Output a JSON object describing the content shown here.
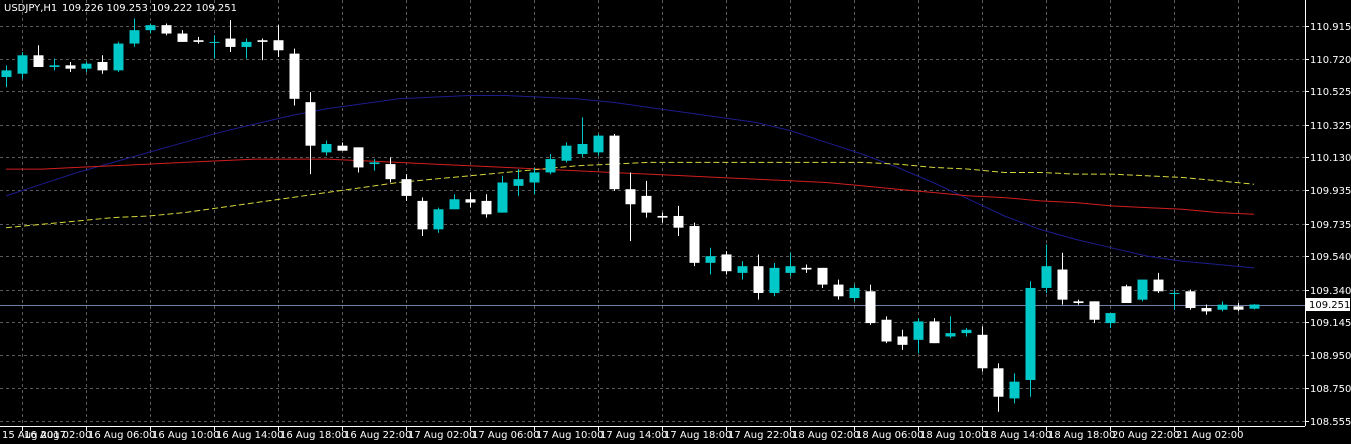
{
  "header": {
    "symbol_timeframe": "USDJPY,H1",
    "ohlc": "109.226 109.253 109.222 109.251"
  },
  "price_box": {
    "label": "109.251"
  },
  "colors": {
    "background": "#000000",
    "bull_candle": "#00c8c8",
    "bear_candle": "#ffffff",
    "ma_fast": "#1c1c8c",
    "ma_mid": "#d21e1e",
    "ma_slow": "#d7d73c",
    "price_line": "#6a7fa5",
    "grid": "#5a5a5a",
    "text": "#ffffff"
  },
  "chart_data": {
    "type": "candlestick",
    "symbol": "USDJPY",
    "timeframe": "H1",
    "ylim": [
      108.555,
      111.0
    ],
    "grid": true,
    "current_price": 109.251,
    "y_ticks": [
      "110.915",
      "110.720",
      "110.525",
      "110.325",
      "110.130",
      "109.935",
      "109.735",
      "109.540",
      "109.340",
      "109.145",
      "108.950",
      "108.750",
      "108.555"
    ],
    "x_ticks": [
      {
        "i": 1,
        "label": "15 Aug 2017"
      },
      {
        "i": 5,
        "label": "16 Aug 02:00"
      },
      {
        "i": 9,
        "label": "16 Aug 06:00"
      },
      {
        "i": 13,
        "label": "16 Aug 10:00"
      },
      {
        "i": 17,
        "label": "16 Aug 14:00"
      },
      {
        "i": 21,
        "label": "16 Aug 18:00"
      },
      {
        "i": 25,
        "label": "16 Aug 22:00"
      },
      {
        "i": 29,
        "label": "17 Aug 02:00"
      },
      {
        "i": 33,
        "label": "17 Aug 06:00"
      },
      {
        "i": 37,
        "label": "17 Aug 10:00"
      },
      {
        "i": 41,
        "label": "17 Aug 14:00"
      },
      {
        "i": 45,
        "label": "17 Aug 18:00"
      },
      {
        "i": 49,
        "label": "17 Aug 22:00"
      },
      {
        "i": 53,
        "label": "18 Aug 02:00"
      },
      {
        "i": 57,
        "label": "18 Aug 06:00"
      },
      {
        "i": 61,
        "label": "18 Aug 10:00"
      },
      {
        "i": 65,
        "label": "18 Aug 14:00"
      },
      {
        "i": 69,
        "label": "18 Aug 18:00"
      },
      {
        "i": 73,
        "label": "20 Aug 22:00"
      },
      {
        "i": 77,
        "label": "21 Aug 02:00"
      }
    ],
    "candles": [
      {
        "o": 110.61,
        "h": 110.68,
        "l": 110.55,
        "c": 110.65
      },
      {
        "o": 110.63,
        "h": 110.76,
        "l": 110.6,
        "c": 110.74
      },
      {
        "o": 110.74,
        "h": 110.8,
        "l": 110.67,
        "c": 110.67
      },
      {
        "o": 110.67,
        "h": 110.72,
        "l": 110.65,
        "c": 110.68
      },
      {
        "o": 110.68,
        "h": 110.7,
        "l": 110.64,
        "c": 110.66
      },
      {
        "o": 110.66,
        "h": 110.7,
        "l": 110.64,
        "c": 110.69
      },
      {
        "o": 110.7,
        "h": 110.74,
        "l": 110.63,
        "c": 110.65
      },
      {
        "o": 110.65,
        "h": 110.82,
        "l": 110.64,
        "c": 110.81
      },
      {
        "o": 110.81,
        "h": 110.96,
        "l": 110.79,
        "c": 110.89
      },
      {
        "o": 110.89,
        "h": 110.93,
        "l": 110.87,
        "c": 110.92
      },
      {
        "o": 110.92,
        "h": 110.93,
        "l": 110.86,
        "c": 110.87
      },
      {
        "o": 110.87,
        "h": 110.89,
        "l": 110.82,
        "c": 110.82
      },
      {
        "o": 110.83,
        "h": 110.85,
        "l": 110.81,
        "c": 110.82
      },
      {
        "o": 110.82,
        "h": 110.86,
        "l": 110.72,
        "c": 110.82
      },
      {
        "o": 110.84,
        "h": 110.95,
        "l": 110.76,
        "c": 110.79
      },
      {
        "o": 110.79,
        "h": 110.84,
        "l": 110.72,
        "c": 110.82
      },
      {
        "o": 110.83,
        "h": 110.84,
        "l": 110.71,
        "c": 110.82
      },
      {
        "o": 110.83,
        "h": 110.92,
        "l": 110.73,
        "c": 110.77
      },
      {
        "o": 110.75,
        "h": 110.78,
        "l": 110.44,
        "c": 110.48
      },
      {
        "o": 110.46,
        "h": 110.52,
        "l": 110.03,
        "c": 110.2
      },
      {
        "o": 110.16,
        "h": 110.23,
        "l": 110.14,
        "c": 110.21
      },
      {
        "o": 110.2,
        "h": 110.22,
        "l": 110.17,
        "c": 110.17
      },
      {
        "o": 110.19,
        "h": 110.19,
        "l": 110.04,
        "c": 110.07
      },
      {
        "o": 110.09,
        "h": 110.12,
        "l": 110.05,
        "c": 110.1
      },
      {
        "o": 110.09,
        "h": 110.13,
        "l": 109.98,
        "c": 110.0
      },
      {
        "o": 110.0,
        "h": 110.03,
        "l": 109.87,
        "c": 109.9
      },
      {
        "o": 109.87,
        "h": 109.89,
        "l": 109.66,
        "c": 109.7
      },
      {
        "o": 109.7,
        "h": 109.83,
        "l": 109.68,
        "c": 109.82
      },
      {
        "o": 109.82,
        "h": 109.91,
        "l": 109.82,
        "c": 109.88
      },
      {
        "o": 109.88,
        "h": 109.92,
        "l": 109.83,
        "c": 109.86
      },
      {
        "o": 109.87,
        "h": 109.91,
        "l": 109.77,
        "c": 109.79
      },
      {
        "o": 109.8,
        "h": 110.02,
        "l": 109.8,
        "c": 109.98
      },
      {
        "o": 109.96,
        "h": 110.06,
        "l": 109.9,
        "c": 110.0
      },
      {
        "o": 109.98,
        "h": 110.07,
        "l": 109.91,
        "c": 110.04
      },
      {
        "o": 110.04,
        "h": 110.15,
        "l": 110.03,
        "c": 110.12
      },
      {
        "o": 110.11,
        "h": 110.22,
        "l": 110.1,
        "c": 110.2
      },
      {
        "o": 110.15,
        "h": 110.37,
        "l": 110.13,
        "c": 110.21
      },
      {
        "o": 110.16,
        "h": 110.27,
        "l": 110.14,
        "c": 110.26
      },
      {
        "o": 110.26,
        "h": 110.27,
        "l": 109.93,
        "c": 109.94
      },
      {
        "o": 109.94,
        "h": 110.04,
        "l": 109.63,
        "c": 109.85
      },
      {
        "o": 109.9,
        "h": 109.99,
        "l": 109.77,
        "c": 109.8
      },
      {
        "o": 109.78,
        "h": 109.8,
        "l": 109.74,
        "c": 109.77
      },
      {
        "o": 109.78,
        "h": 109.84,
        "l": 109.66,
        "c": 109.71
      },
      {
        "o": 109.72,
        "h": 109.74,
        "l": 109.48,
        "c": 109.5
      },
      {
        "o": 109.5,
        "h": 109.59,
        "l": 109.43,
        "c": 109.54
      },
      {
        "o": 109.55,
        "h": 109.57,
        "l": 109.43,
        "c": 109.45
      },
      {
        "o": 109.44,
        "h": 109.51,
        "l": 109.4,
        "c": 109.48
      },
      {
        "o": 109.48,
        "h": 109.55,
        "l": 109.28,
        "c": 109.32
      },
      {
        "o": 109.32,
        "h": 109.5,
        "l": 109.3,
        "c": 109.47
      },
      {
        "o": 109.44,
        "h": 109.56,
        "l": 109.42,
        "c": 109.48
      },
      {
        "o": 109.47,
        "h": 109.49,
        "l": 109.44,
        "c": 109.46
      },
      {
        "o": 109.47,
        "h": 109.47,
        "l": 109.35,
        "c": 109.37
      },
      {
        "o": 109.37,
        "h": 109.4,
        "l": 109.28,
        "c": 109.3
      },
      {
        "o": 109.29,
        "h": 109.37,
        "l": 109.27,
        "c": 109.35
      },
      {
        "o": 109.33,
        "h": 109.37,
        "l": 109.13,
        "c": 109.14
      },
      {
        "o": 109.16,
        "h": 109.18,
        "l": 109.02,
        "c": 109.03
      },
      {
        "o": 109.06,
        "h": 109.1,
        "l": 108.98,
        "c": 109.01
      },
      {
        "o": 109.04,
        "h": 109.17,
        "l": 108.96,
        "c": 109.15
      },
      {
        "o": 109.15,
        "h": 109.17,
        "l": 109.02,
        "c": 109.02
      },
      {
        "o": 109.06,
        "h": 109.18,
        "l": 109.05,
        "c": 109.08
      },
      {
        "o": 109.08,
        "h": 109.11,
        "l": 109.06,
        "c": 109.1
      },
      {
        "o": 109.07,
        "h": 109.12,
        "l": 108.85,
        "c": 108.87
      },
      {
        "o": 108.87,
        "h": 108.9,
        "l": 108.61,
        "c": 108.7
      },
      {
        "o": 108.69,
        "h": 108.84,
        "l": 108.66,
        "c": 108.79
      },
      {
        "o": 108.8,
        "h": 109.39,
        "l": 108.7,
        "c": 109.35
      },
      {
        "o": 109.35,
        "h": 109.61,
        "l": 109.32,
        "c": 109.48
      },
      {
        "o": 109.46,
        "h": 109.56,
        "l": 109.25,
        "c": 109.28
      },
      {
        "o": 109.27,
        "h": 109.28,
        "l": 109.25,
        "c": 109.26
      },
      {
        "o": 109.27,
        "h": 109.27,
        "l": 109.14,
        "c": 109.16
      },
      {
        "o": 109.14,
        "h": 109.2,
        "l": 109.11,
        "c": 109.2
      },
      {
        "o": 109.36,
        "h": 109.37,
        "l": 109.26,
        "c": 109.26
      },
      {
        "o": 109.28,
        "h": 109.4,
        "l": 109.27,
        "c": 109.4
      },
      {
        "o": 109.4,
        "h": 109.44,
        "l": 109.32,
        "c": 109.33
      },
      {
        "o": 109.32,
        "h": 109.34,
        "l": 109.22,
        "c": 109.32
      },
      {
        "o": 109.33,
        "h": 109.34,
        "l": 109.22,
        "c": 109.23
      },
      {
        "o": 109.23,
        "h": 109.25,
        "l": 109.19,
        "c": 109.21
      },
      {
        "o": 109.22,
        "h": 109.27,
        "l": 109.21,
        "c": 109.25
      },
      {
        "o": 109.24,
        "h": 109.26,
        "l": 109.21,
        "c": 109.22
      },
      {
        "o": 109.226,
        "h": 109.253,
        "l": 109.222,
        "c": 109.251
      }
    ],
    "moving_averages": [
      {
        "color": "#1c1c8c",
        "dashed": false,
        "values": [
          109.9,
          109.97,
          110.04,
          110.1,
          110.16,
          110.22,
          110.28,
          110.33,
          110.38,
          110.42,
          110.45,
          110.48,
          110.49,
          110.5,
          110.5,
          110.49,
          110.48,
          110.46,
          110.43,
          110.4,
          110.37,
          110.34,
          110.29,
          110.22,
          110.15,
          110.07,
          109.98,
          109.88,
          109.78,
          109.7,
          109.64,
          109.59,
          109.54,
          109.51,
          109.49,
          109.47
        ]
      },
      {
        "color": "#d21e1e",
        "dashed": false,
        "values": [
          110.06,
          110.06,
          110.07,
          110.08,
          110.09,
          110.1,
          110.11,
          110.12,
          110.12,
          110.12,
          110.11,
          110.1,
          110.09,
          110.08,
          110.07,
          110.06,
          110.05,
          110.04,
          110.03,
          110.02,
          110.01,
          110.0,
          109.99,
          109.98,
          109.96,
          109.94,
          109.92,
          109.9,
          109.89,
          109.87,
          109.86,
          109.84,
          109.83,
          109.82,
          109.8,
          109.79
        ]
      },
      {
        "color": "#d7d73c",
        "dashed": true,
        "values": [
          109.71,
          109.73,
          109.75,
          109.77,
          109.78,
          109.8,
          109.83,
          109.86,
          109.89,
          109.92,
          109.95,
          109.98,
          110.0,
          110.02,
          110.04,
          110.06,
          110.08,
          110.09,
          110.1,
          110.1,
          110.1,
          110.1,
          110.1,
          110.1,
          110.1,
          110.09,
          110.07,
          110.06,
          110.04,
          110.04,
          110.03,
          110.03,
          110.02,
          110.01,
          109.99,
          109.97
        ]
      }
    ]
  }
}
